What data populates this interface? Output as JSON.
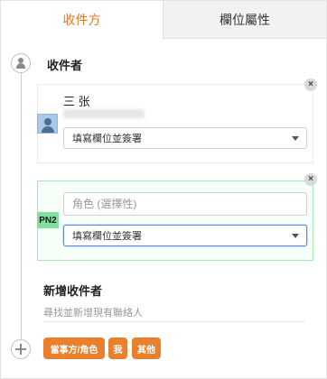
{
  "tabs": [
    {
      "label": "收件方",
      "active": true
    },
    {
      "label": "欄位屬性",
      "active": false
    }
  ],
  "section": {
    "title": "收件者"
  },
  "recipient1": {
    "name": "三 张",
    "field_select": "填寫欄位並簽署"
  },
  "recipient2": {
    "badge": "PN2",
    "role_placeholder": "角色 (選擇性)",
    "field_select": "填寫欄位並簽署"
  },
  "add_recipient": {
    "title": "新增收件者",
    "search_placeholder": "尋找並新增現有聯絡人"
  },
  "chips": [
    {
      "label": "當事方/角色"
    },
    {
      "label": "我"
    },
    {
      "label": "其他"
    }
  ],
  "close_symbol": "×",
  "colors": {
    "accent": "#e9802d",
    "badge": "#7fe0a0",
    "active_select_border": "#5b8ed8"
  },
  "icons": [
    "person-icon",
    "plus-icon",
    "avatar-icon",
    "close-icon",
    "caret-down-icon"
  ]
}
